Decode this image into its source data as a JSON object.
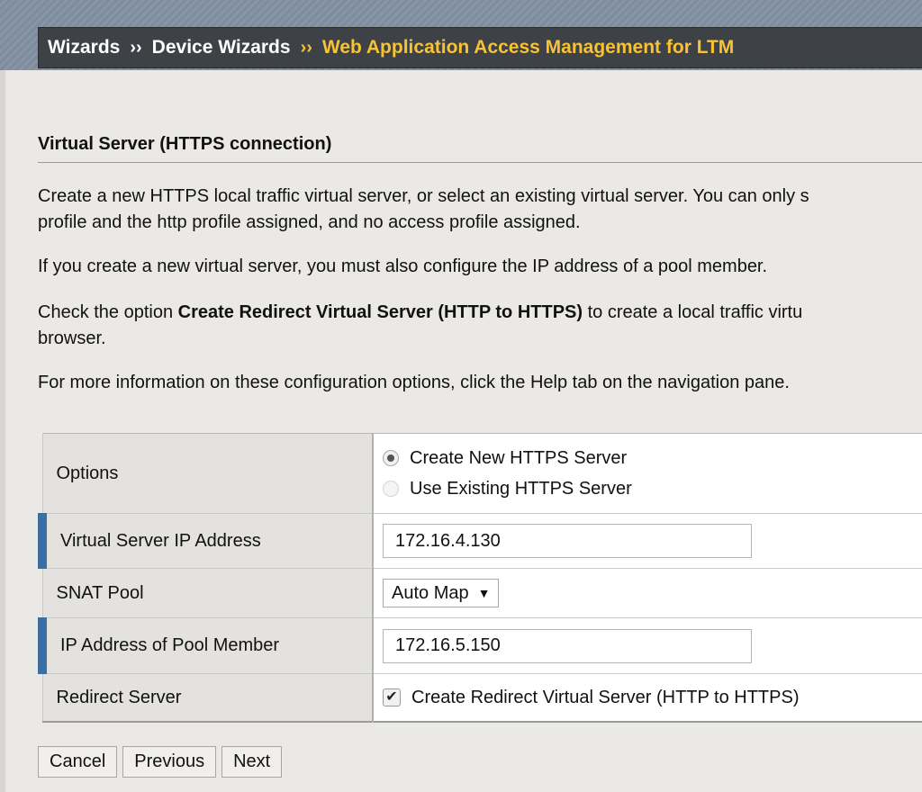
{
  "breadcrumb": {
    "item1": "Wizards",
    "item2": "Device Wizards",
    "current": "Web Application Access Management for LTM",
    "separator": "››"
  },
  "section": {
    "title": "Virtual Server (HTTPS connection)",
    "para1_line1": "Create a new HTTPS local traffic virtual server, or select an existing virtual server. You can only s",
    "para1_line2": "profile and the http profile assigned, and no access profile assigned.",
    "para2": "If you create a new virtual server, you must also configure the IP address of a pool member.",
    "para3_prefix": "Check the option ",
    "para3_bold": "Create Redirect Virtual Server (HTTP to HTTPS)",
    "para3_suffix": " to create a local traffic virtu",
    "para3_line2": "browser.",
    "para4": "For more information on these configuration options, click the Help tab on the navigation pane."
  },
  "form": {
    "options_label": "Options",
    "option_new": "Create New HTTPS Server",
    "option_existing": "Use Existing HTTPS Server",
    "vip_label": "Virtual Server IP Address",
    "vip_value": "172.16.4.130",
    "snat_label": "SNAT Pool",
    "snat_value": "Auto Map",
    "pool_ip_label": "IP Address of Pool Member",
    "pool_ip_value": "172.16.5.150",
    "redirect_label": "Redirect Server",
    "redirect_checkbox": "Create Redirect Virtual Server (HTTP to HTTPS)"
  },
  "buttons": {
    "cancel": "Cancel",
    "previous": "Previous",
    "next": "Next"
  },
  "colors": {
    "breadcrumb_current": "#f7c334",
    "required_marker": "#3b6fa3"
  }
}
